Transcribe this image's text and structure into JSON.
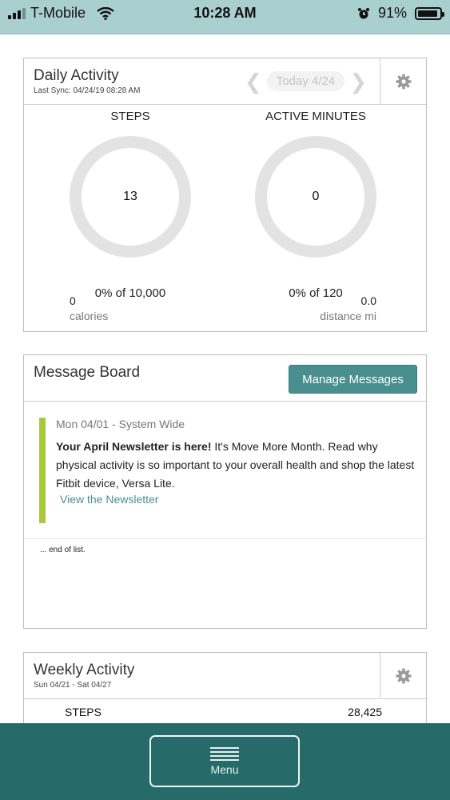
{
  "status_bar": {
    "carrier": "T-Mobile",
    "time": "10:28 AM",
    "battery_percent": "91%",
    "battery_level": 0.91
  },
  "daily_activity": {
    "title": "Daily Activity",
    "last_sync": "Last Sync: 04/24/19 08:28 AM",
    "date_label": "Today  4/24",
    "steps": {
      "label": "STEPS",
      "value": "13",
      "progress": "0% of 10,000"
    },
    "active_minutes": {
      "label": "ACTIVE MINUTES",
      "value": "0",
      "progress": "0% of 120"
    },
    "calories": {
      "value": "0",
      "label": "calories"
    },
    "distance": {
      "value": "0.0",
      "label": "distance mi"
    }
  },
  "message_board": {
    "title": "Message Board",
    "manage_label": "Manage Messages",
    "messages": [
      {
        "meta": "Mon 04/01 - System Wide",
        "headline": "Your April Newsletter is here!",
        "body": " It's Move More Month. Read why physical activity is so important to your overall health and shop the latest Fitbit device, Versa Lite.",
        "link": "View the Newsletter"
      }
    ],
    "end_text": "... end of list."
  },
  "weekly_activity": {
    "title": "Weekly Activity",
    "range": "Sun 04/21 - Sat 04/27",
    "rows": [
      {
        "label": "STEPS",
        "value": "28,425"
      }
    ]
  },
  "bottom_nav": {
    "menu_label": "Menu"
  },
  "colors": {
    "accent": "#4a8f8f",
    "status_bar": "#a9cfcf",
    "bottom_bar": "#276a6a",
    "message_bar": "#a9c93c"
  }
}
